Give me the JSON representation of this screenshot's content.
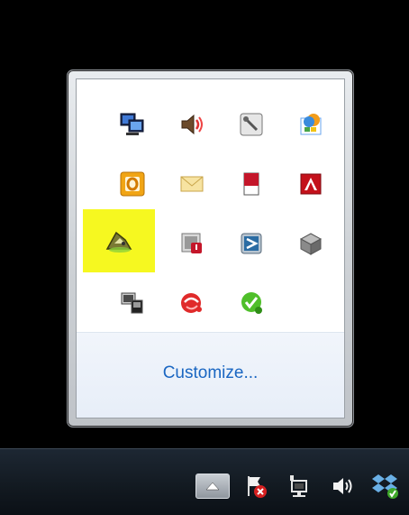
{
  "flyout": {
    "customize_label": "Customize...",
    "icons": [
      {
        "name": "monitor-network-icon"
      },
      {
        "name": "speaker-volume-icon"
      },
      {
        "name": "wrench-tool-icon"
      },
      {
        "name": "windows-update-icon"
      },
      {
        "name": "outlook-icon"
      },
      {
        "name": "envelope-mail-icon"
      },
      {
        "name": "red-flag-sheet-icon"
      },
      {
        "name": "adobe-icon"
      },
      {
        "name": "yellow-bell-app-icon",
        "highlighted": true
      },
      {
        "name": "shield-alert-icon"
      },
      {
        "name": "blue-arrow-app-icon"
      },
      {
        "name": "gray-cube-icon"
      },
      {
        "name": "computer-devices-icon"
      },
      {
        "name": "red-circle-app-icon"
      },
      {
        "name": "green-check-bubble-icon"
      }
    ],
    "highlight_color": "#f6f820"
  },
  "taskbar": {
    "tray": [
      {
        "name": "show-hidden-icons-button"
      },
      {
        "name": "action-center-flag-icon"
      },
      {
        "name": "network-icon"
      },
      {
        "name": "volume-icon"
      },
      {
        "name": "dropbox-icon"
      }
    ]
  },
  "colors": {
    "link": "#1a66c2",
    "taskbar": "#121920"
  }
}
